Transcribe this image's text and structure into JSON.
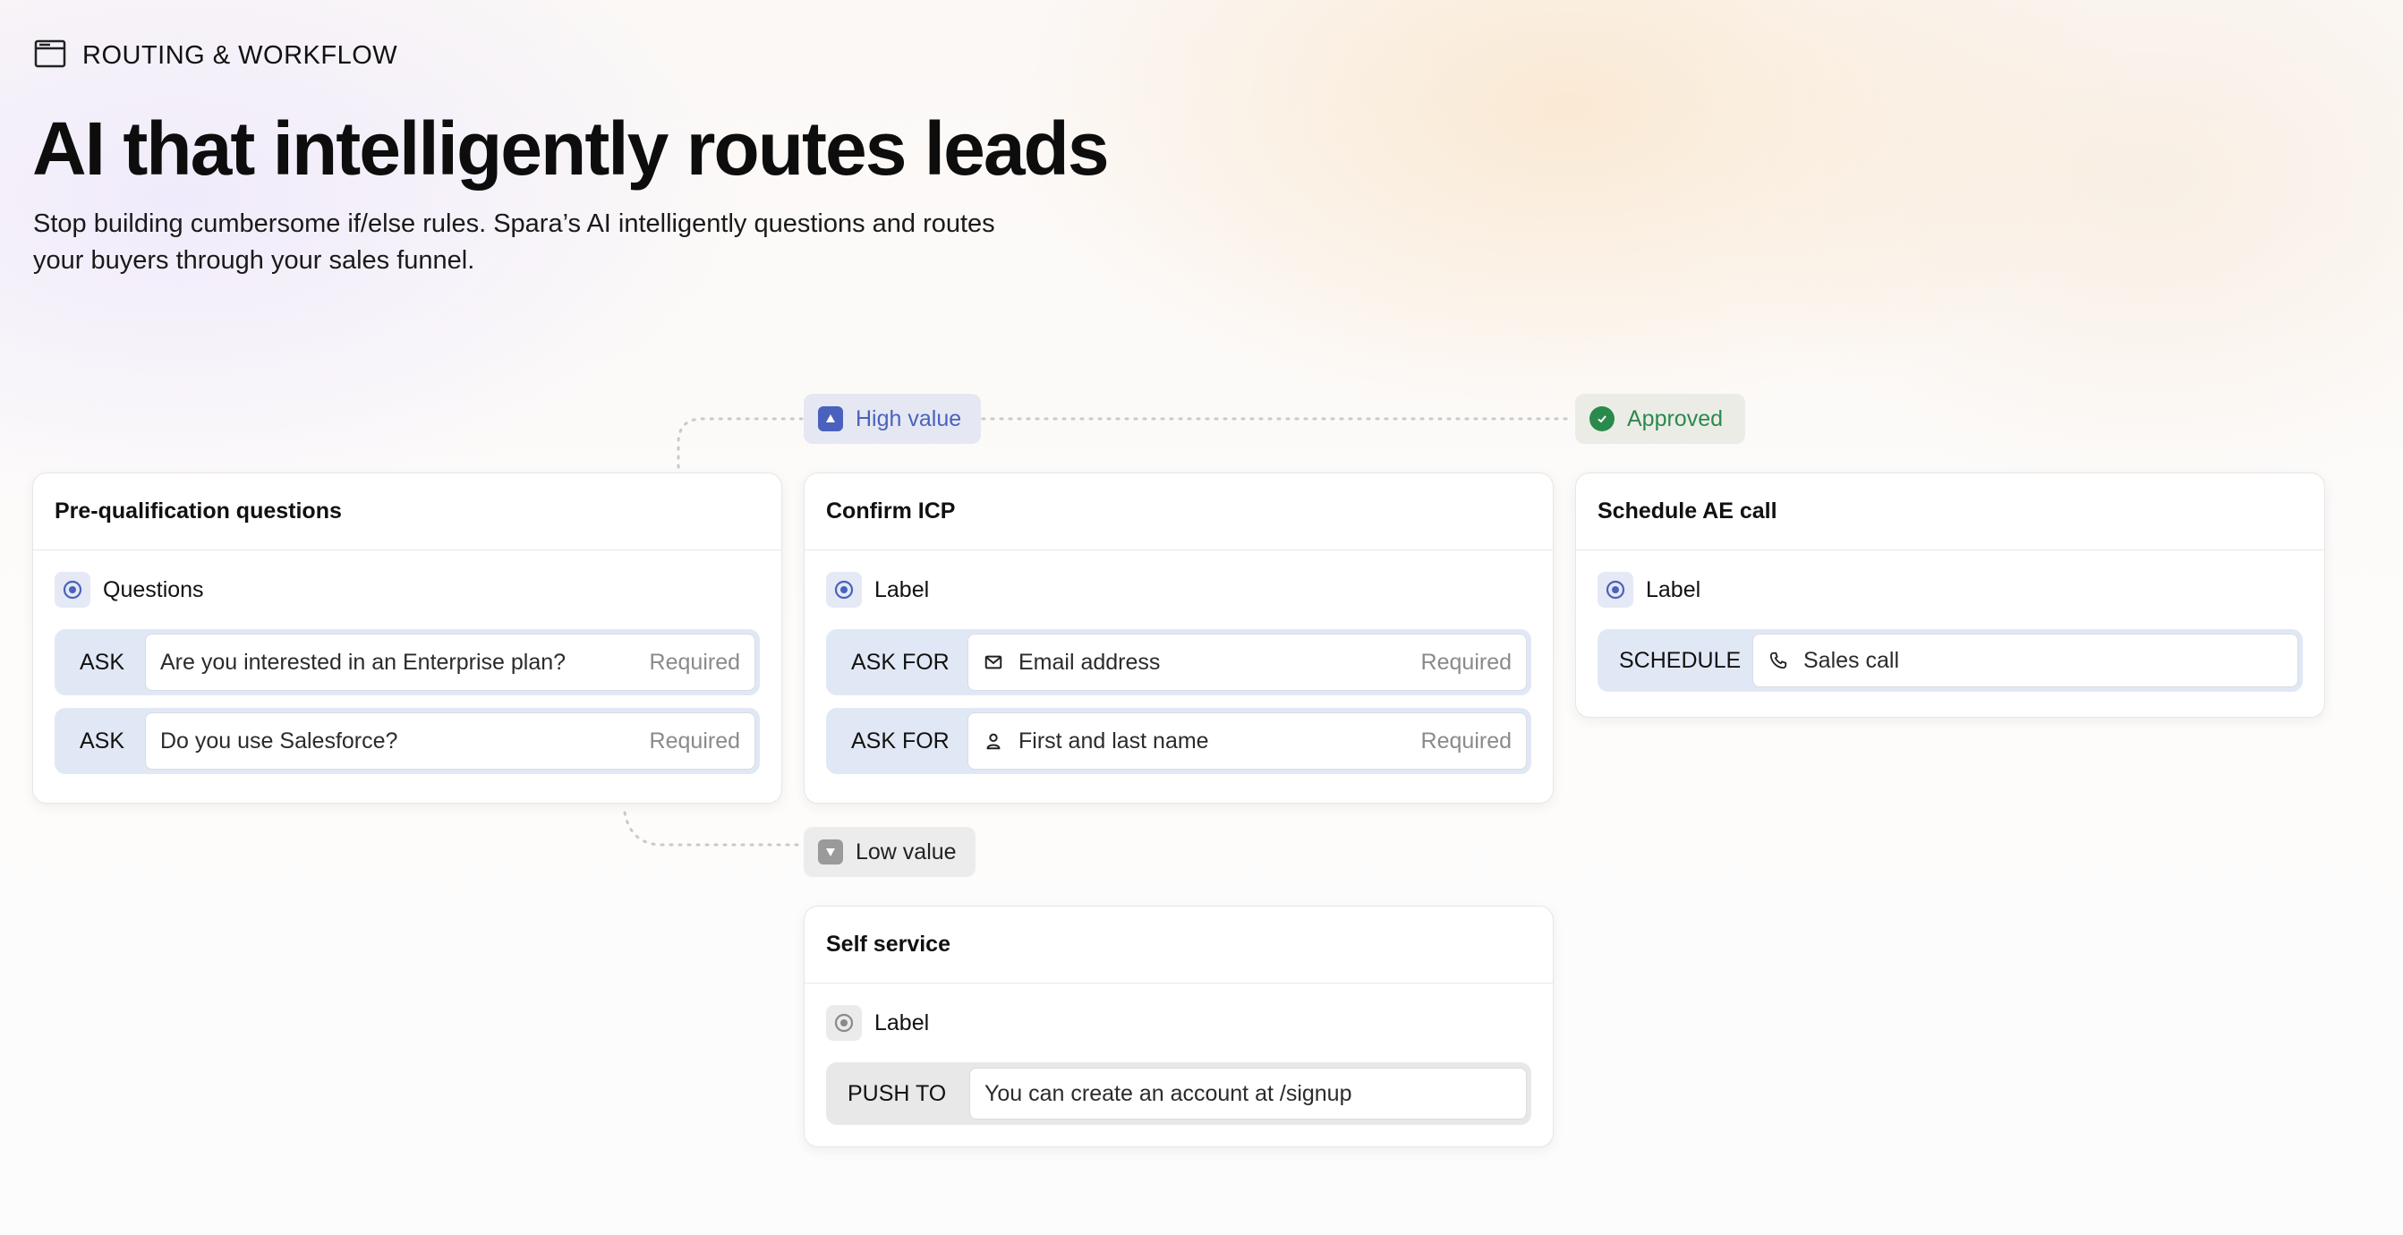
{
  "eyebrow": {
    "label": "ROUTING & WORKFLOW",
    "icon": "browser-window-icon"
  },
  "headline": "AI that intelligently routes leads",
  "subhead_line1": "Stop building cumbersome if/else rules. Spara’s AI intelligently questions and routes",
  "subhead_line2": "your buyers through your sales funnel.",
  "pills": {
    "high_value": {
      "label": "High value",
      "icon": "triangle-up-icon",
      "color": "#4a62bd"
    },
    "approved": {
      "label": "Approved",
      "icon": "check-circle-icon",
      "color": "#2a8a4c"
    },
    "low_value": {
      "label": "Low value",
      "icon": "triangle-down-icon",
      "color": "#9a9a9a"
    }
  },
  "cards": {
    "prequal": {
      "title": "Pre-qualification questions",
      "section_label": "Questions",
      "rows": [
        {
          "tag": "ASK",
          "value": "Are you interested in an Enterprise plan?",
          "required": "Required"
        },
        {
          "tag": "ASK",
          "value": "Do you use Salesforce?",
          "required": "Required"
        }
      ]
    },
    "confirm_icp": {
      "title": "Confirm ICP",
      "section_label": "Label",
      "rows": [
        {
          "tag": "ASK FOR",
          "value": "Email address",
          "required": "Required",
          "icon": "mail-icon"
        },
        {
          "tag": "ASK FOR",
          "value": "First and last name",
          "required": "Required",
          "icon": "person-icon"
        }
      ]
    },
    "schedule": {
      "title": "Schedule AE call",
      "section_label": "Label",
      "rows": [
        {
          "tag": "SCHEDULE",
          "value": "Sales call",
          "icon": "phone-icon"
        }
      ]
    },
    "self_service": {
      "title": "Self service",
      "section_label": "Label",
      "rows": [
        {
          "tag": "PUSH TO",
          "value": "You can create an account at /signup"
        }
      ]
    }
  },
  "colors": {
    "accent_blue": "#4a62bd",
    "approved_green": "#2a8a4c",
    "row_blue": "#e1e8f5",
    "row_grey": "#e8e8e8"
  }
}
